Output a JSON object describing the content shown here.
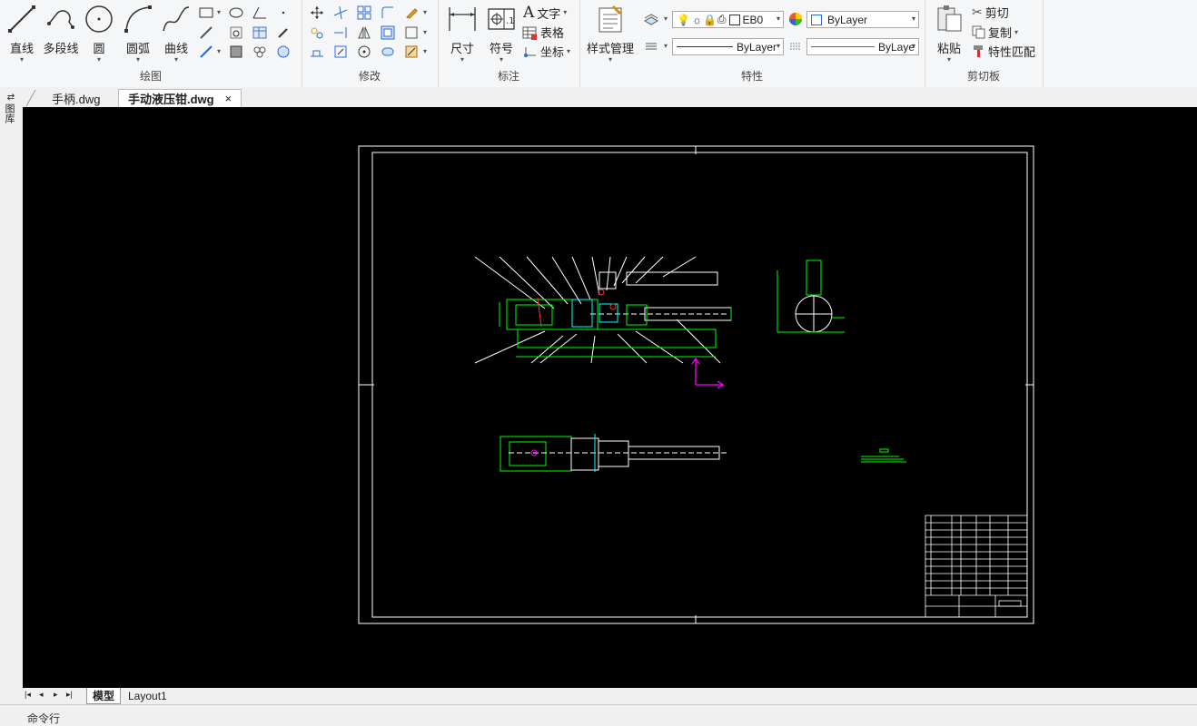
{
  "ribbon": {
    "draw": {
      "title": "绘图",
      "line": "直线",
      "polyline": "多段线",
      "circle": "圆",
      "arc": "圆弧",
      "spline": "曲线"
    },
    "modify": {
      "title": "修改"
    },
    "annotate": {
      "title": "标注",
      "dimension": "尺寸",
      "symbol": "符号",
      "text": "文字",
      "table": "表格",
      "coordinate": "坐标"
    },
    "properties": {
      "title": "特性",
      "style_manager": "样式管理",
      "layer_name": "EB0",
      "color": "ByLayer",
      "linetype": "ByLayer",
      "lineweight": "ByLaye"
    },
    "clipboard": {
      "title": "剪切板",
      "paste": "粘贴",
      "cut": "剪切",
      "copy": "复制",
      "match": "特性匹配"
    }
  },
  "tabs": [
    {
      "label": "手柄.dwg"
    },
    {
      "label": "手动液压钳.dwg"
    }
  ],
  "sidebar": {
    "label": "图库"
  },
  "layout_tabs": [
    {
      "label": "模型"
    },
    {
      "label": "Layout1"
    }
  ],
  "command_line": {
    "label": "命令行"
  },
  "colors": {
    "canvas": "#000000",
    "frame": "#ffffff",
    "drawing_green": "#00ff00",
    "ucs": "#ff00ff",
    "accent_red": "#ff3030",
    "cyan": "#00ffff"
  }
}
